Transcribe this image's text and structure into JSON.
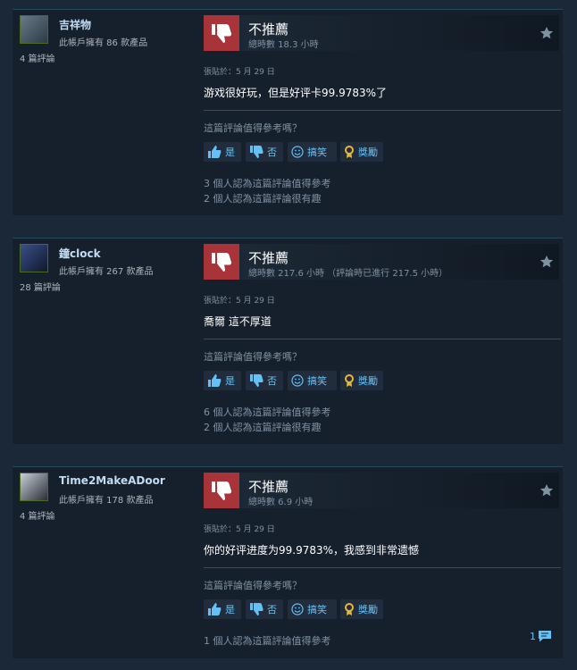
{
  "reviews": [
    {
      "author": "吉祥物",
      "owned": "此帳戶擁有 86 款產品",
      "review_count": "4 篇評論",
      "recommendation": "不推薦",
      "hours": "總時數 18.3 小時",
      "posted": "張貼於：5 月 29 日",
      "text": "游戏很好玩，但是好评卡99.9783%了",
      "helpful_question": "這篇評論值得參考嗎？",
      "stat_helpful": "3 個人認為這篇評論值得參考",
      "stat_funny": "2 個人認為這篇評論很有趣",
      "comments": ""
    },
    {
      "author": "鐘clock",
      "owned": "此帳戶擁有 267 款產品",
      "review_count": "28 篇評論",
      "recommendation": "不推薦",
      "hours": "總時數 217.6 小時 （評論時已進行 217.5 小時）",
      "posted": "張貼於：5 月 29 日",
      "text": "喬爾 這不厚道",
      "helpful_question": "這篇評論值得參考嗎？",
      "stat_helpful": "6 個人認為這篇評論值得參考",
      "stat_funny": "2 個人認為這篇評論很有趣",
      "comments": ""
    },
    {
      "author": "Time2MakeADoor",
      "owned": "此帳戶擁有 178 款產品",
      "review_count": "4 篇評論",
      "recommendation": "不推薦",
      "hours": "總時數 6.9 小時",
      "posted": "張貼於：5 月 29 日",
      "text": "你的好评进度为99.9783%，我感到非常遗憾",
      "helpful_question": "這篇評論值得參考嗎？",
      "stat_helpful": "1 個人認為這篇評論值得參考",
      "stat_funny": "",
      "comments": "1"
    }
  ],
  "buttons": {
    "yes": "是",
    "no": "否",
    "funny": "搞笑",
    "award": "獎勵"
  },
  "colors": {
    "thumb_down_bg": "#a8343a",
    "link": "#66c0f4",
    "award_gold": "#e5b83a"
  },
  "icons": [
    "thumbs-down-icon",
    "star-icon",
    "thumbs-up-icon",
    "smiley-icon",
    "award-icon",
    "comment-icon"
  ]
}
